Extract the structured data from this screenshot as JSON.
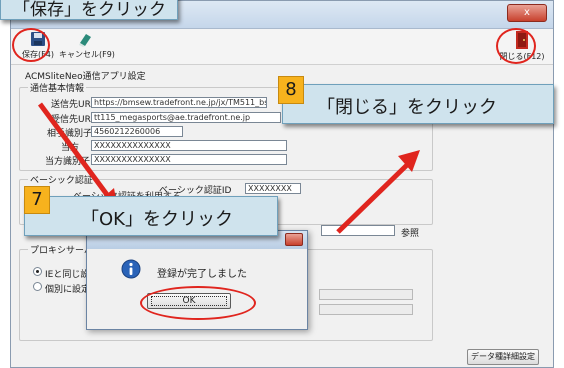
{
  "callout_top": {
    "label": "「保存」をクリック"
  },
  "window": {
    "close_label": "x",
    "toolbar": {
      "save_label": "保存(F4)",
      "cancel_label": "キャンセル(F9)",
      "close_label": "閉じる(F12)"
    },
    "app_title": "ACMSliteNeo通信アプリ設定",
    "comm_group": {
      "title": "通信基本情報",
      "send_url_label": "送信先URL",
      "send_url_value": "https://bmsew.tradefront.ne.jp/jx/TM511_bs",
      "dest_url_label": "受信先URL",
      "dest_url_value": "tt115_megasports@ae.tradefront.ne.jp",
      "partner_id_label": "相手識別子",
      "partner_id_value": "4560212260006",
      "own_label": "当方",
      "own_value": "XXXXXXXXXXXXXX",
      "own_id_label": "当方識別子",
      "own_id_value": "XXXXXXXXXXXXXX"
    },
    "auth_group": {
      "title": "ベーシック認証",
      "use_label": "ベーシック認証を利用する",
      "basic_id_label": "ベーシック認証ID",
      "basic_id_value": "XXXXXXXX"
    },
    "browse_label": "参照",
    "proxy_group": {
      "title": "プロキシサーバー",
      "option_ie": "IEと同じ設定",
      "option_individual": "個別に設定"
    },
    "detail_button": "データ種詳細設定"
  },
  "dialog": {
    "message": "登録が完了しました",
    "ok_label": "OK"
  },
  "step7": {
    "number": "7",
    "label": "「OK」をクリック"
  },
  "step8": {
    "number": "8",
    "label": "「閉じる」をクリック"
  },
  "colors": {
    "callout_bg": "#cfe3ed",
    "step_badge": "#f7b21d",
    "highlight_red": "#e0251e"
  }
}
